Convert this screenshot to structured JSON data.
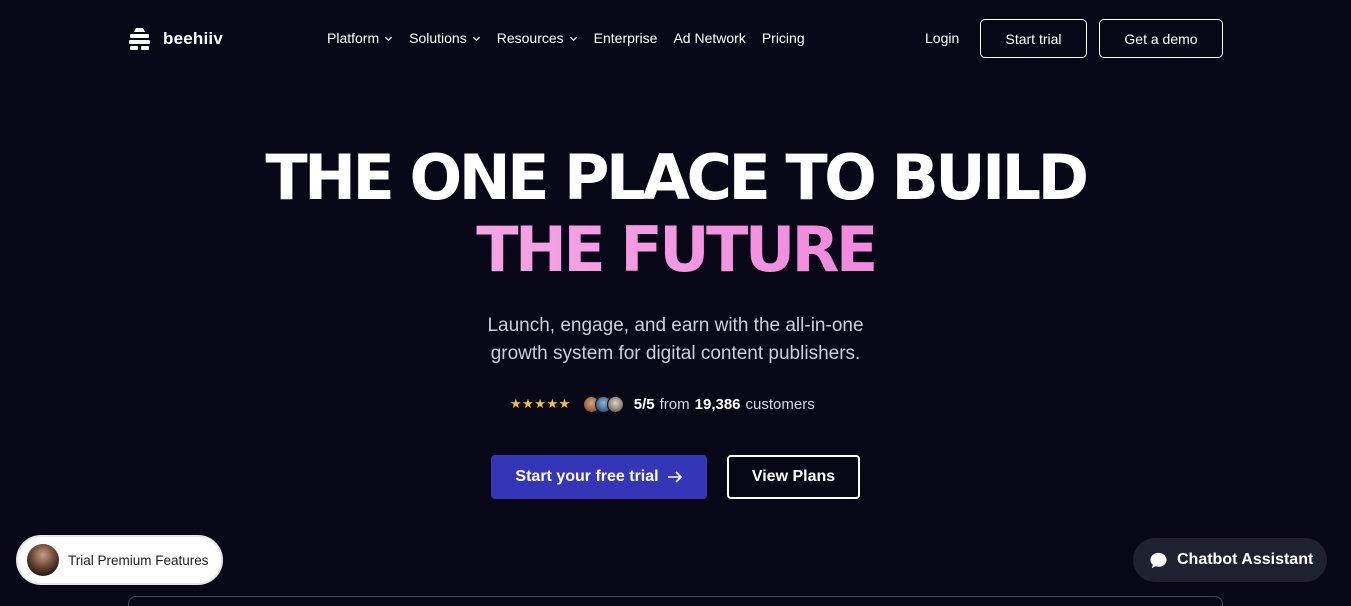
{
  "nav": {
    "logo_text": "beehiiv",
    "menu": [
      {
        "label": "Platform",
        "dropdown": true
      },
      {
        "label": "Solutions",
        "dropdown": true
      },
      {
        "label": "Resources",
        "dropdown": true
      },
      {
        "label": "Enterprise",
        "dropdown": false
      },
      {
        "label": "Ad Network",
        "dropdown": false
      },
      {
        "label": "Pricing",
        "dropdown": false
      }
    ],
    "login_label": "Login",
    "start_trial_label": "Start trial",
    "demo_label": "Get a demo"
  },
  "hero": {
    "headline_line1": "THE ONE PLACE TO BUILD",
    "headline_line2": "THE FUTURE",
    "subtitle_line1": "Launch, engage, and earn with the all-in-one",
    "subtitle_line2": "growth system for digital content publishers.",
    "rating": {
      "stars": "★★★★★",
      "score": "5/5",
      "from_text": "from",
      "count": "19,386",
      "suffix": "customers"
    },
    "primary_cta": "Start your free trial",
    "primary_cta_arrow": "→",
    "secondary_cta": "View Plans"
  },
  "floating": {
    "trial_chip_label": "Trial Premium Features",
    "chatbot_label": "Chatbot Assistant"
  },
  "colors": {
    "background": "#080717",
    "primary_button": "#3535b8",
    "headline_gradient_start": "#f9c1ec",
    "headline_gradient_end": "#e964d4",
    "star": "#f6c348"
  },
  "icons": [
    "beehiiv-logo-icon",
    "chevron-down-icon",
    "arrow-right-icon",
    "chat-bubble-icon"
  ]
}
